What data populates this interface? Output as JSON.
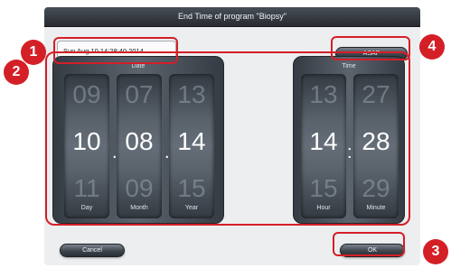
{
  "dialog": {
    "title": "End Time of program \"Biopsy\"",
    "datetime_text": "Sun Aug 10 14:28:40 2014",
    "asap_label": "ASAP",
    "cancel_label": "Cancel",
    "ok_label": "OK"
  },
  "date_picker": {
    "label": "Date",
    "columns": [
      {
        "label": "Day",
        "prev": "09",
        "value": "10",
        "next": "11"
      },
      {
        "label": "Month",
        "prev": "07",
        "value": "08",
        "next": "09"
      },
      {
        "label": "Year",
        "prev": "13",
        "value": "14",
        "next": "15"
      }
    ],
    "separator": "."
  },
  "time_picker": {
    "label": "Time",
    "columns": [
      {
        "label": "Hour",
        "prev": "13",
        "value": "14",
        "next": "15"
      },
      {
        "label": "Minute",
        "prev": "27",
        "value": "28",
        "next": "29"
      }
    ],
    "separator": ":"
  },
  "callouts": [
    "1",
    "2",
    "3",
    "4"
  ],
  "colors": {
    "callout": "#d41f27",
    "dialog_bg": "#eceef0",
    "titlebar": "#2d3238",
    "picker_digit": "#ffffff"
  }
}
